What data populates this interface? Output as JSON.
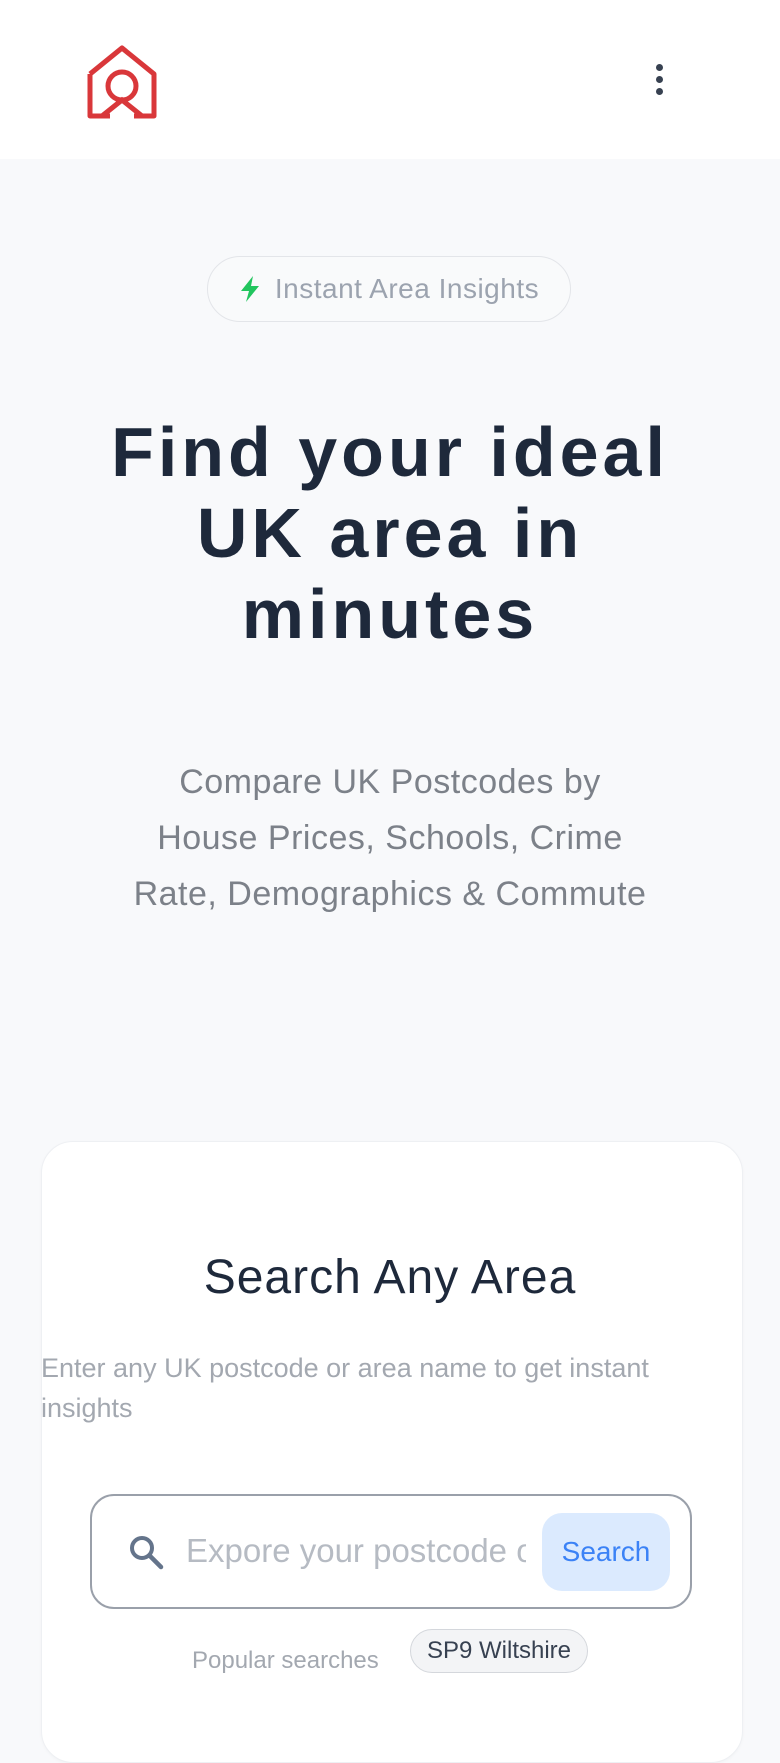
{
  "colors": {
    "brand": "#d9373a",
    "accent_green": "#22c55e",
    "search_button_bg": "#dbeafe",
    "search_button_text": "#3b82f6"
  },
  "header": {
    "logo_icon": "house-location-logo-icon",
    "menu_icon": "vertical-dots-menu-icon"
  },
  "hero": {
    "badge_icon": "lightning-bolt-icon",
    "badge_label": "Instant Area Insights",
    "title": "Find your ideal UK area in minutes",
    "subtitle": "Compare UK Postcodes by House Prices, Schools, Crime Rate, Demographics & Commute"
  },
  "search": {
    "title": "Search Any Area",
    "description": "Enter any UK postcode or area name to get instant insights",
    "input_placeholder": "Expore your postcode or area",
    "input_value": "",
    "button_label": "Search",
    "popular_label": "Popular searches",
    "popular_items": [
      "SP9 Wiltshire"
    ]
  }
}
